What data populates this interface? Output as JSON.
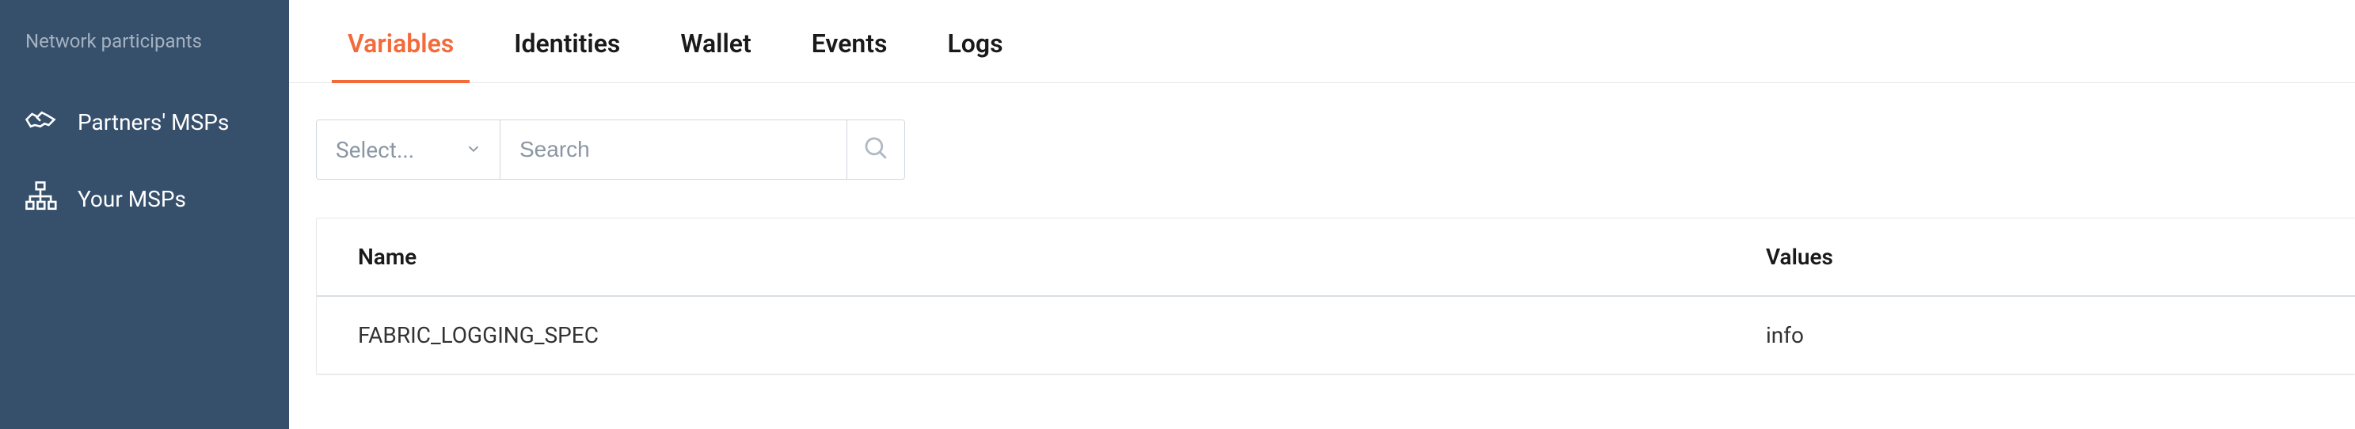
{
  "sidebar": {
    "section_title": "Network participants",
    "items": [
      {
        "label": "Partners' MSPs"
      },
      {
        "label": "Your MSPs"
      }
    ]
  },
  "tabs": [
    {
      "label": "Variables",
      "active": true
    },
    {
      "label": "Identities",
      "active": false
    },
    {
      "label": "Wallet",
      "active": false
    },
    {
      "label": "Events",
      "active": false
    },
    {
      "label": "Logs",
      "active": false
    }
  ],
  "filter": {
    "select_placeholder": "Select...",
    "search_placeholder": "Search"
  },
  "table": {
    "columns": {
      "name": "Name",
      "values": "Values"
    },
    "rows": [
      {
        "name": "FABRIC_LOGGING_SPEC",
        "values": "info"
      }
    ]
  }
}
